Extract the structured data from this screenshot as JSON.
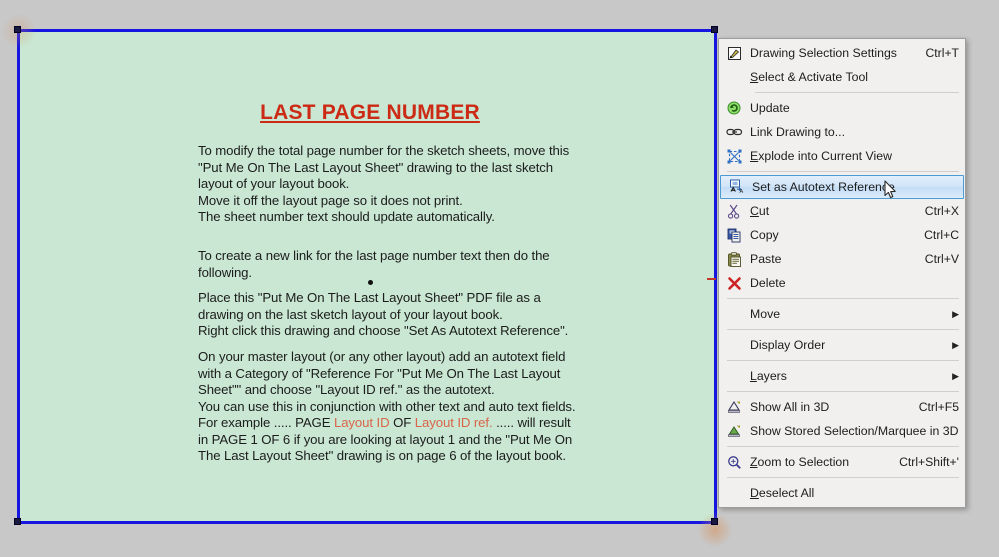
{
  "canvas": {
    "background_color": "#c8c8c8",
    "drawing": {
      "background_color": "#c9e7d2",
      "border_color": "#1616e0",
      "title": "LAST PAGE NUMBER",
      "title_color": "#cc2a15",
      "accent_color": "#d9654a",
      "paragraphs": {
        "p1": "To modify the total page number for the sketch sheets, move this\n\"Put Me On The Last Layout Sheet\" drawing to the last sketch\nlayout of your layout book.\nMove it off the layout page so it does not print.\nThe sheet number text should update automatically.",
        "p2": "To create a new link for the last page number text then do the\nfollowing.",
        "p3": "Place this \"Put Me On The Last Layout Sheet\" PDF file as a\ndrawing on the last sketch layout of your layout book.\nRight click this drawing and choose \"Set As Autotext Reference\".",
        "p4_line1": "On your master layout (or any other layout) add an autotext field",
        "p4_line2": "with a Category of \"Reference For \"Put Me On The Last Layout",
        "p4_line3": "Sheet\"\" and choose \"Layout ID ref.\" as the autotext.",
        "p4_line4": "You can use this in conjunction with other text and auto text fields.",
        "p4_line5_a": "For example ..... PAGE ",
        "p4_line5_b": "Layout ID",
        "p4_line5_c": " OF ",
        "p4_line5_d": "Layout ID ref.",
        "p4_line5_e": " ..... will result",
        "p4_line6": "in PAGE 1 OF 6 if you are looking at layout 1 and the \"Put Me On",
        "p4_line7": "The Last Layout Sheet\" drawing is on page 6 of the layout book."
      }
    }
  },
  "context_menu": {
    "items": [
      {
        "id": "drawing-selection-settings",
        "label": "Drawing Selection Settings",
        "accel": "Ctrl+T",
        "icon": "drawing-selection-icon",
        "selected": false,
        "arrow": false
      },
      {
        "id": "select-activate-tool",
        "label": "Select & Activate Tool",
        "accel": "",
        "icon": "",
        "selected": false,
        "arrow": false
      },
      {
        "id": "update",
        "label": "Update",
        "accel": "",
        "icon": "update-icon",
        "selected": false,
        "arrow": false
      },
      {
        "id": "link-drawing-to",
        "label": "Link Drawing to...",
        "accel": "",
        "icon": "link-icon",
        "selected": false,
        "arrow": false
      },
      {
        "id": "explode-into-current-view",
        "label": "Explode into Current View",
        "accel": "",
        "icon": "explode-icon",
        "selected": false,
        "arrow": false
      },
      {
        "id": "set-as-autotext-reference",
        "label": "Set as Autotext Reference",
        "accel": "",
        "icon": "autotext-icon",
        "selected": true,
        "arrow": false
      },
      {
        "id": "cut",
        "label": "Cut",
        "accel": "Ctrl+X",
        "icon": "scissors-icon",
        "selected": false,
        "arrow": false
      },
      {
        "id": "copy",
        "label": "Copy",
        "accel": "Ctrl+C",
        "icon": "copy-icon",
        "selected": false,
        "arrow": false
      },
      {
        "id": "paste",
        "label": "Paste",
        "accel": "Ctrl+V",
        "icon": "paste-icon",
        "selected": false,
        "arrow": false
      },
      {
        "id": "delete",
        "label": "Delete",
        "accel": "",
        "icon": "delete-x-icon",
        "selected": false,
        "arrow": false
      },
      {
        "id": "move",
        "label": "Move",
        "accel": "",
        "icon": "",
        "selected": false,
        "arrow": true
      },
      {
        "id": "display-order",
        "label": "Display Order",
        "accel": "",
        "icon": "",
        "selected": false,
        "arrow": true
      },
      {
        "id": "layers",
        "label": "Layers",
        "accel": "",
        "icon": "",
        "selected": false,
        "arrow": true
      },
      {
        "id": "show-all-in-3d",
        "label": "Show All in 3D",
        "accel": "Ctrl+F5",
        "icon": "show-3d-icon",
        "selected": false,
        "arrow": false
      },
      {
        "id": "show-stored-selection-marquee-in-3d",
        "label": "Show Stored Selection/Marquee in 3D",
        "accel": "",
        "icon": "show-marquee-3d-icon",
        "selected": false,
        "arrow": false
      },
      {
        "id": "zoom-to-selection",
        "label": "Zoom to Selection",
        "accel": "Ctrl+Shift+'",
        "icon": "zoom-selection-icon",
        "selected": false,
        "arrow": false
      },
      {
        "id": "deselect-all",
        "label": "Deselect All",
        "accel": "",
        "icon": "",
        "selected": false,
        "arrow": false
      }
    ],
    "highlight_color": "#cfe4f8",
    "highlight_border_color": "#4b9ad4",
    "background_color": "#f1f0ef"
  },
  "labels": {
    "menu_item_0": "Drawing Selection Settings",
    "menu_item_1": "Select & Activate Tool",
    "menu_item_2": "Update",
    "menu_item_3": "Link Drawing to...",
    "menu_item_4": "Explode into Current View",
    "menu_item_5": "Set as Autotext Reference",
    "menu_item_6": "Cut",
    "menu_item_7": "Copy",
    "menu_item_8": "Paste",
    "menu_item_9": "Delete",
    "menu_item_10": "Move",
    "menu_item_11": "Display Order",
    "menu_item_12": "Layers",
    "menu_item_13": "Show All in 3D",
    "menu_item_14": "Show Stored Selection/Marquee in 3D",
    "menu_item_15": "Zoom to Selection",
    "menu_item_16": "Deselect All"
  },
  "accels": {
    "menu_item_0": "Ctrl+T",
    "menu_item_6": "Ctrl+X",
    "menu_item_7": "Ctrl+C",
    "menu_item_8": "Ctrl+V",
    "menu_item_13": "Ctrl+F5",
    "menu_item_15": "Ctrl+Shift+'"
  }
}
